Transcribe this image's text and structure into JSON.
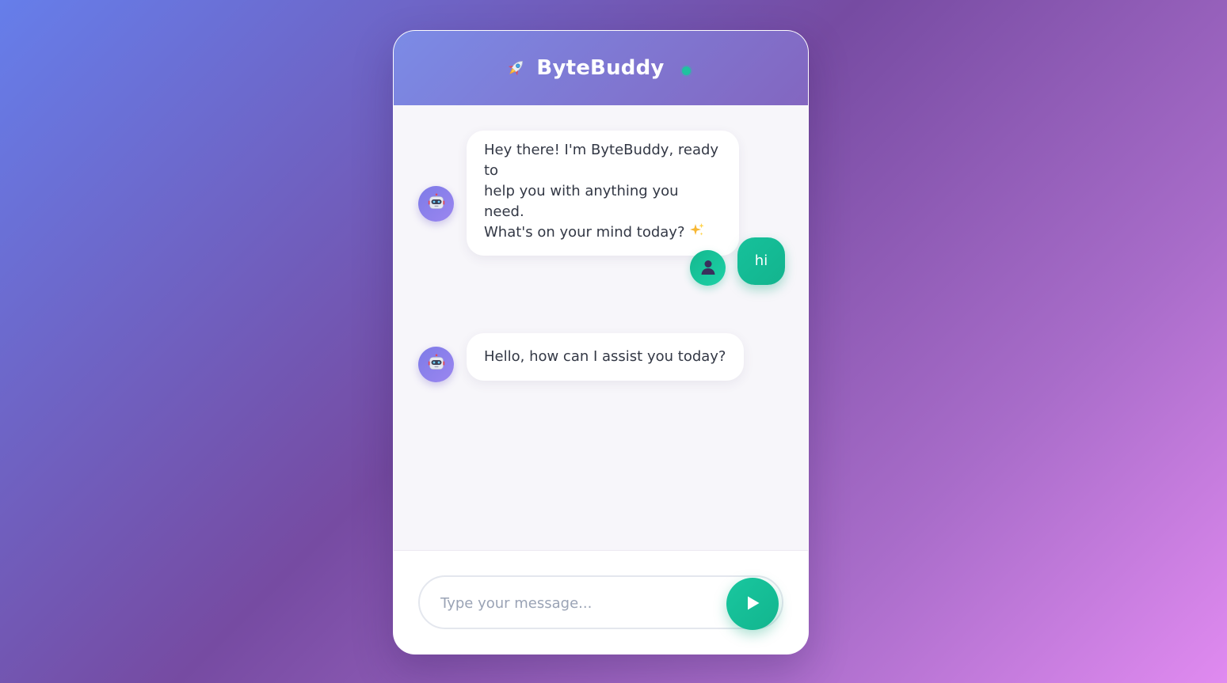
{
  "header": {
    "title": "ByteBuddy",
    "logo_icon": "rocket-icon",
    "status": "online",
    "status_color": "#1fc2a0"
  },
  "messages": [
    {
      "sender": "bot",
      "avatar_icon": "robot-icon",
      "lines": [
        "Hey there! I'm ByteBuddy, ready to",
        "help you with anything you need.",
        "What's on your mind today?"
      ],
      "trailing_icon": "sparkles-icon"
    },
    {
      "sender": "user",
      "avatar_icon": "user-silhouette-icon",
      "text": "hi"
    },
    {
      "sender": "bot",
      "avatar_icon": "robot-icon",
      "text": "Hello, how can I assist you today?"
    }
  ],
  "composer": {
    "placeholder": "Type your message...",
    "value": "",
    "send_icon": "play-icon"
  },
  "colors": {
    "accent": "#16c19b",
    "header_gradient_start": "#7b8be6",
    "header_gradient_end": "#8366c0",
    "bot_avatar": "#8a80ea"
  }
}
